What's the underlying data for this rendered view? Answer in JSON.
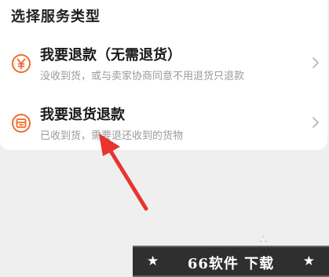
{
  "header": {
    "title": "选择服务类型"
  },
  "options": [
    {
      "title": "我要退款（无需退货）",
      "subtitle": "没收到货，或与卖家协商同意不用退货只退款",
      "icon": "yen-circle-icon"
    },
    {
      "title": "我要退货退款",
      "subtitle": "已收到货，需要退还收到的货物",
      "icon": "return-goods-icon"
    }
  ],
  "watermark": {
    "text": "66软件 下载",
    "star": "★"
  },
  "colors": {
    "accent": "#f46a2b",
    "annotation_arrow": "#e8332f"
  }
}
